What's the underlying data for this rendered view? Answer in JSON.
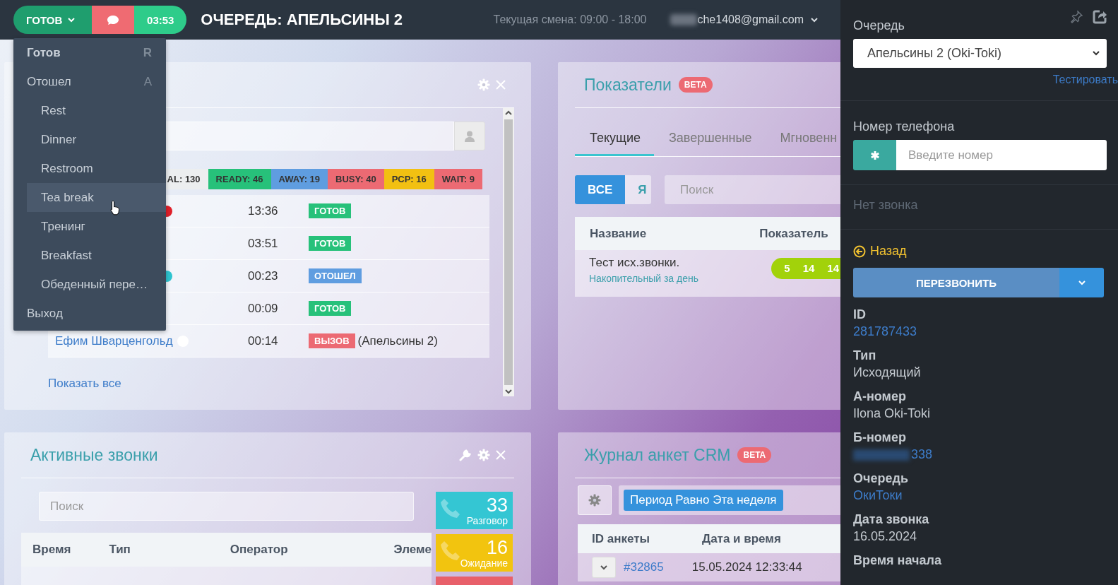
{
  "topbar": {
    "status_button": "ГОТОВ",
    "timer": "03:53",
    "title": "ОЧЕРЕДЬ: АПЕЛЬСИНЫ 2",
    "shift": "Текущая смена: 09:00 - 18:00",
    "account": "che1408@gmail.com",
    "account_masked": true
  },
  "status_menu": {
    "items": [
      {
        "label": "Готов",
        "key": "R",
        "current": true,
        "highlighted": false
      },
      {
        "label": "Отошел",
        "key": "A",
        "current": false,
        "highlighted": false,
        "children": [
          {
            "label": "Rest",
            "highlighted": false
          },
          {
            "label": "Dinner",
            "highlighted": false
          },
          {
            "label": "Restroom",
            "highlighted": false
          },
          {
            "label": "Tea break",
            "highlighted": true
          },
          {
            "label": "Тренинг",
            "highlighted": false
          },
          {
            "label": "Breakfast",
            "highlighted": false
          },
          {
            "label": "Обеденный пере…",
            "highlighted": false
          }
        ]
      },
      {
        "label": "Выход",
        "current": false,
        "highlighted": false
      }
    ]
  },
  "agents_panel": {
    "counters": [
      {
        "label": "AL: 130",
        "color": "#eceeef"
      },
      {
        "label": "READY: 46",
        "color": "#27c17a"
      },
      {
        "label": "AWAY: 19",
        "color": "#5f9de0"
      },
      {
        "label": "BUSY: 40",
        "color": "#ec6a73"
      },
      {
        "label": "PCP: 16",
        "color": "#f2c012"
      },
      {
        "label": "WAIT: 9",
        "color": "#ec6a73"
      }
    ],
    "rows": [
      {
        "dot": {
          "color": "#e0202a"
        },
        "time": "13:36",
        "badge": {
          "label": "ГОТОВ",
          "color": "#27c17a"
        }
      },
      {
        "time": "03:51",
        "badge": {
          "label": "ГОТОВ",
          "color": "#27c17a"
        }
      },
      {
        "dot": {
          "color": "#2ec4d0"
        },
        "time": "00:23",
        "badge": {
          "label": "ОТОШЕЛ",
          "color": "#5f9de0"
        }
      },
      {
        "time": "00:09",
        "badge": {
          "label": "ГОТОВ",
          "color": "#27c17a"
        }
      },
      {
        "name": "Ефим Шварценгольд",
        "dot": {
          "color": "#ffffff"
        },
        "time": "00:14",
        "badge": {
          "label": "ВЫЗОВ",
          "color": "#ec6a73"
        },
        "queue": "(Апельсины 2)"
      }
    ],
    "show_all": "Показать все"
  },
  "metrics_panel": {
    "title": "Показатели",
    "badge": "BETA",
    "tabs": [
      {
        "label": "Текущие",
        "selected": true
      },
      {
        "label": "Завершенные",
        "selected": false
      },
      {
        "label": "Мгновенн",
        "selected": false
      }
    ],
    "filter": [
      {
        "label": "ВСЕ",
        "selected": true
      },
      {
        "label": "Я",
        "selected": false
      }
    ],
    "search_placeholder": "Поиск",
    "columns": [
      "Название",
      "Показатель"
    ],
    "rows": [
      {
        "name": "Тест исх.звонки.",
        "subtitle": "Накопительный за день",
        "values": [
          "5",
          "14",
          "14"
        ]
      }
    ]
  },
  "active_calls": {
    "title": "Активные звонки",
    "search_placeholder": "Поиск",
    "columns": [
      "Время",
      "Тип",
      "Оператор",
      "Элеме"
    ],
    "counters": [
      {
        "value": "33",
        "label": "Разговор",
        "color": "#34c6d3"
      },
      {
        "value": "16",
        "label": "Ожидание",
        "color": "#f2c40f"
      },
      {
        "color": "#e8606a"
      }
    ]
  },
  "crm_panel": {
    "title": "Журнал анкет CRM",
    "badge": "BETA",
    "filter_chip": "Период Равно Эта неделя",
    "columns": [
      "ID анкеты",
      "Дата и время"
    ],
    "rows": [
      {
        "id": "#32865",
        "datetime": "15.05.2024 12:33:44"
      }
    ]
  },
  "sidebar": {
    "queue_label": "Очередь",
    "queue_select": "Апельсины 2 (Oki-Toki)",
    "test_link": "Тестировать",
    "phone_label": "Номер телефона",
    "phone_placeholder": "Введите номер",
    "call_status": "Нет звонка",
    "back_link": "Назад",
    "callback_button": "ПЕРЕЗВОНИТЬ",
    "details": [
      {
        "label": "ID",
        "value": "281787433",
        "kind": "link"
      },
      {
        "label": "Тип",
        "value": "Исходящий",
        "kind": "text"
      },
      {
        "label": "А-номер",
        "value": "Ilona Oki-Toki",
        "kind": "text"
      },
      {
        "label": "Б-номер",
        "value": "338",
        "kind": "masked"
      },
      {
        "label": "Очередь",
        "value": "ОкиТоки",
        "kind": "link"
      },
      {
        "label": "Дата звонка",
        "value": "16.05.2024",
        "kind": "text"
      },
      {
        "label": "Время начала"
      }
    ]
  }
}
